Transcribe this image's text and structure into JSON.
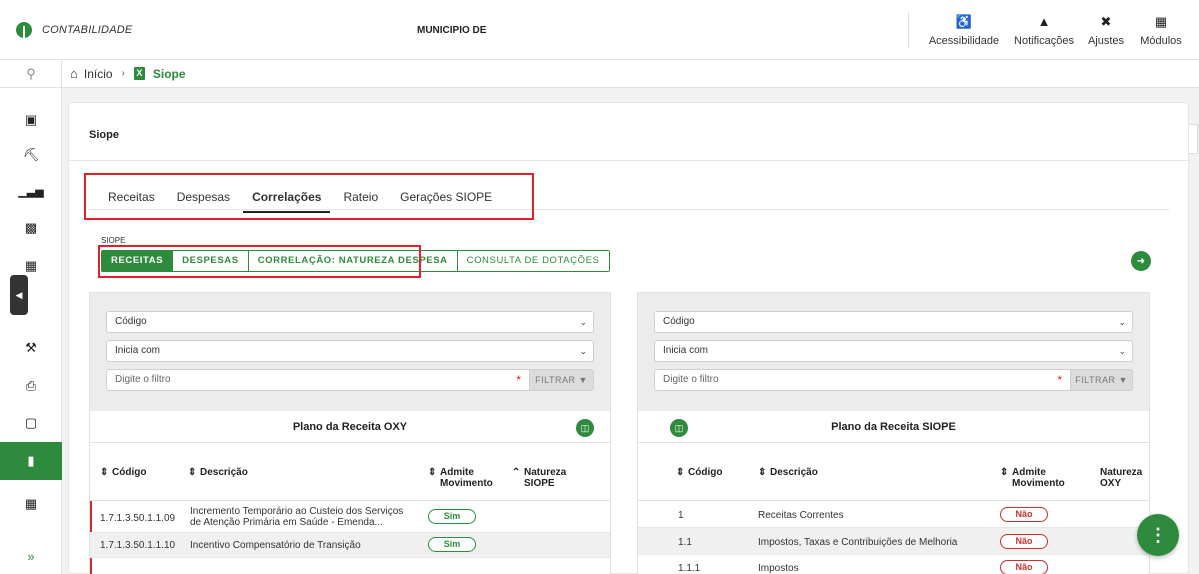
{
  "header": {
    "app_title": "CONTABILIDADE",
    "municipality": "MUNICIPIO DE",
    "actions": [
      {
        "label": "Acessibilidade",
        "icon": "accessibility-icon",
        "glyph": "♿"
      },
      {
        "label": "Notificações",
        "icon": "bell-icon",
        "glyph": "🔔"
      },
      {
        "label": "Ajustes",
        "icon": "tools-icon",
        "glyph": "✖"
      },
      {
        "label": "Módulos",
        "icon": "grid-icon",
        "glyph": "▦"
      }
    ]
  },
  "breadcrumb": {
    "home": "Início",
    "current": "Siope"
  },
  "card": {
    "title": "Siope",
    "tabs": [
      "Receitas",
      "Despesas",
      "Correlações",
      "Rateio",
      "Gerações SIOPE"
    ],
    "active_tab": "Correlações",
    "siope_label": "SIOPE",
    "segments": [
      "RECEITAS",
      "DESPESAS",
      "CORRELAÇÃO: NATUREZA DESPESA",
      "CONSULTA DE DOTAÇÕES"
    ],
    "active_segment": "RECEITAS"
  },
  "left_panel": {
    "select1": "Código",
    "select2": "Inicia com",
    "filter_placeholder": "Digite o filtro",
    "filter_button": "FILTRAR",
    "plan_title": "Plano da Receita OXY",
    "columns": [
      "Código",
      "Descrição",
      "Admite Movimento",
      "Natureza SIOPE"
    ],
    "rows": [
      {
        "codigo": "1.7.1.3.50.1.1.09",
        "descricao": "Incremento Temporário ao Custeio dos Serviços de Atenção Primária em Saúde - Emenda...",
        "admite": "Sim"
      },
      {
        "codigo": "1.7.1.3.50.1.1.10",
        "descricao": "Incentivo Compensatório de Transição",
        "admite": "Sim"
      }
    ]
  },
  "right_panel": {
    "select1": "Código",
    "select2": "Inicia com",
    "filter_placeholder": "Digite o filtro",
    "filter_button": "FILTRAR",
    "plan_title": "Plano da Receita SIOPE",
    "columns": [
      "Código",
      "Descrição",
      "Admite Movimento",
      "Natureza OXY"
    ],
    "rows": [
      {
        "codigo": "1",
        "descricao": "Receitas Correntes",
        "admite": "Não"
      },
      {
        "codigo": "1.1",
        "descricao": "Impostos, Taxas e Contribuições de Melhoria",
        "admite": "Não"
      },
      {
        "codigo": "1.1.1",
        "descricao": "Impostos",
        "admite": "Não"
      }
    ]
  },
  "colors": {
    "brand_green": "#2e8b3d",
    "highlight_red": "#e0202a"
  }
}
